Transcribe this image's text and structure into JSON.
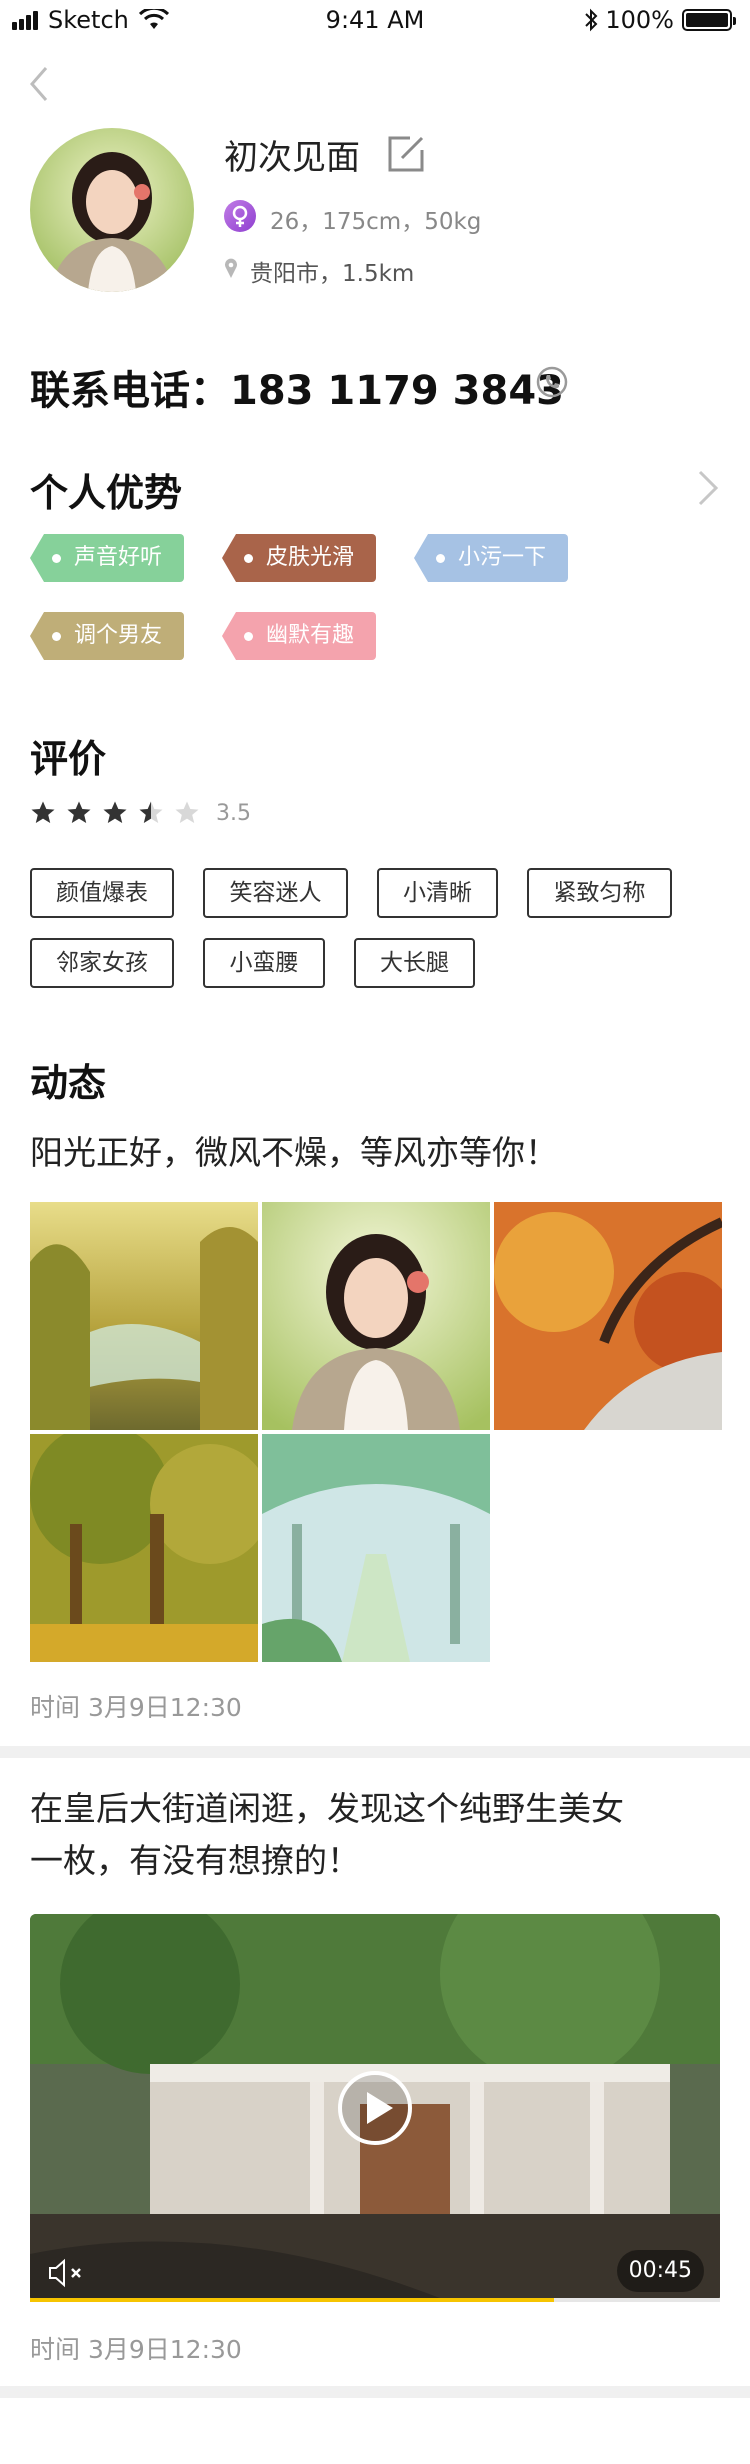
{
  "status_bar": {
    "carrier": "Sketch",
    "time": "9:41 AM",
    "battery": "100%",
    "icons": [
      "signal-icon",
      "wifi-icon",
      "bluetooth-icon",
      "battery-icon"
    ]
  },
  "profile": {
    "nickname": "初次见面",
    "stats": "26，175cm，50kg",
    "location": "贵阳市，1.5km",
    "phone_text": "联系电话：183 1179 3843",
    "gender_color": "#a55cdb"
  },
  "advantages": {
    "title": "个人优势",
    "tags": [
      {
        "label": "声音好听",
        "color": "#86d19a"
      },
      {
        "label": "皮肤光滑",
        "color": "#a9644a"
      },
      {
        "label": "小污一下",
        "color": "#a6c2e4"
      },
      {
        "label": "调个男友",
        "color": "#bfae78"
      },
      {
        "label": "幽默有趣",
        "color": "#f4a3ad"
      }
    ]
  },
  "review": {
    "title": "评价",
    "rating": 3.5,
    "rating_text": "3.5",
    "tags": [
      "颜值爆表",
      "笑容迷人",
      "小清晰",
      "紧致匀称",
      "邻家女孩",
      "小蛮腰",
      "大长腿"
    ]
  },
  "feed": {
    "title": "动态",
    "posts": [
      {
        "text": "阳光正好，微风不燥，等风亦等你！",
        "image_count": 5,
        "time": "时间  3月9日12:30"
      },
      {
        "text_line1": "在皇后大街道闲逛，发现这个纯野生美女",
        "text_line2": "一枚，有没有想撩的！",
        "duration": "00:45",
        "progress": 0.76,
        "time": "时间  3月9日12:30"
      }
    ]
  },
  "colors": {
    "accent": "#f6c400",
    "divider": "#f0f0f0"
  }
}
